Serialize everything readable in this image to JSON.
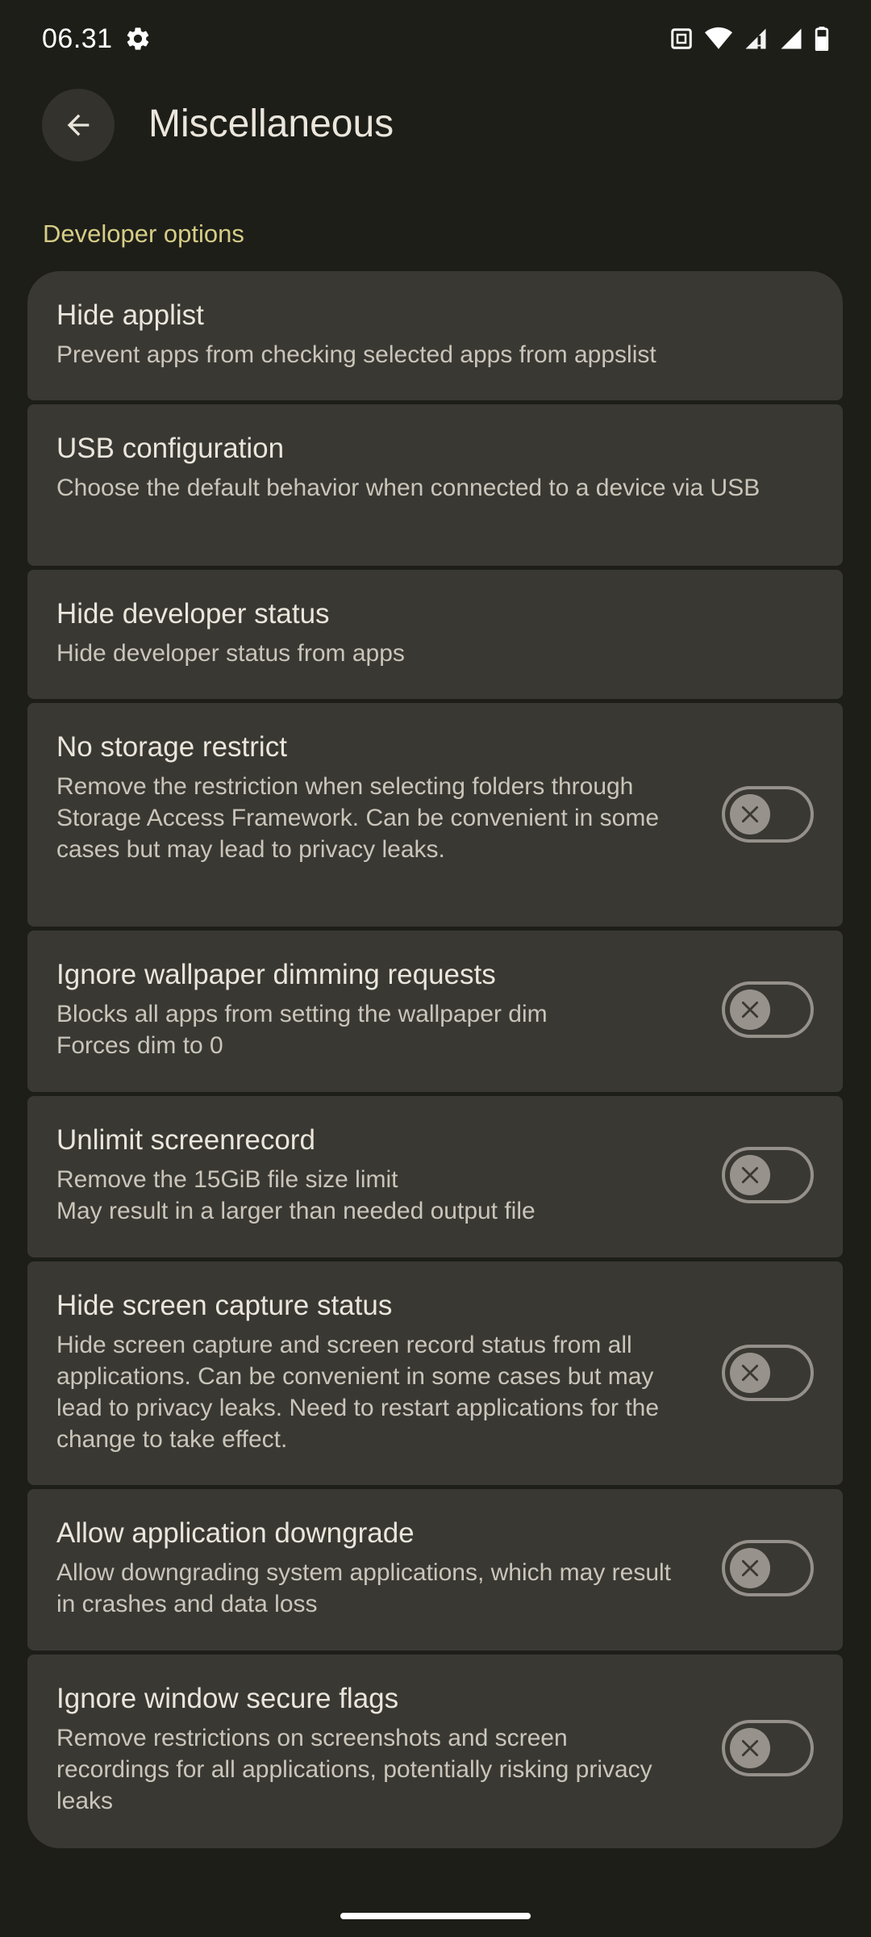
{
  "status_bar": {
    "time": "06.31",
    "icons": [
      "settings-gear-icon",
      "nfc-icon",
      "wifi-icon",
      "signal-icon",
      "signal-icon",
      "battery-icon"
    ]
  },
  "app_bar": {
    "back_icon": "arrow-back-icon",
    "title": "Miscellaneous"
  },
  "section": {
    "header": "Developer options"
  },
  "settings": [
    {
      "title": "Hide applist",
      "summary": "Prevent apps from checking selected apps from appslist",
      "has_toggle": false
    },
    {
      "title": "USB configuration",
      "summary": "Choose the default behavior when connected to a device via USB",
      "has_toggle": false
    },
    {
      "title": "Hide developer status",
      "summary": "Hide developer status from apps",
      "has_toggle": false
    },
    {
      "title": "No storage restrict",
      "summary": "Remove the restriction when selecting folders through Storage Access Framework. Can be convenient in some cases but may lead to privacy leaks.",
      "has_toggle": true,
      "checked": false
    },
    {
      "title": "Ignore wallpaper dimming requests",
      "summary": "Blocks all apps from setting the wallpaper dim\nForces dim to 0",
      "has_toggle": true,
      "checked": false
    },
    {
      "title": "Unlimit screenrecord",
      "summary": "Remove the 15GiB file size limit\nMay result in a larger than needed output file",
      "has_toggle": true,
      "checked": false
    },
    {
      "title": "Hide screen capture status",
      "summary": "Hide screen capture and screen record status from all applications. Can be convenient in some cases but may lead to privacy leaks. Need to restart applications for the change to take effect.",
      "has_toggle": true,
      "checked": false
    },
    {
      "title": "Allow application downgrade",
      "summary": "Allow downgrading system applications, which may result in crashes and data loss",
      "has_toggle": true,
      "checked": false
    },
    {
      "title": "Ignore window secure flags",
      "summary": "Remove restrictions on screenshots and screen recordings for all applications, potentially risking privacy leaks",
      "has_toggle": true,
      "checked": false
    }
  ],
  "colors": {
    "background": "#1e1e19",
    "card": "#3a3833",
    "accent": "#d6cd86",
    "title_text": "#ebe6dc",
    "summary_text": "#cac5ba"
  }
}
